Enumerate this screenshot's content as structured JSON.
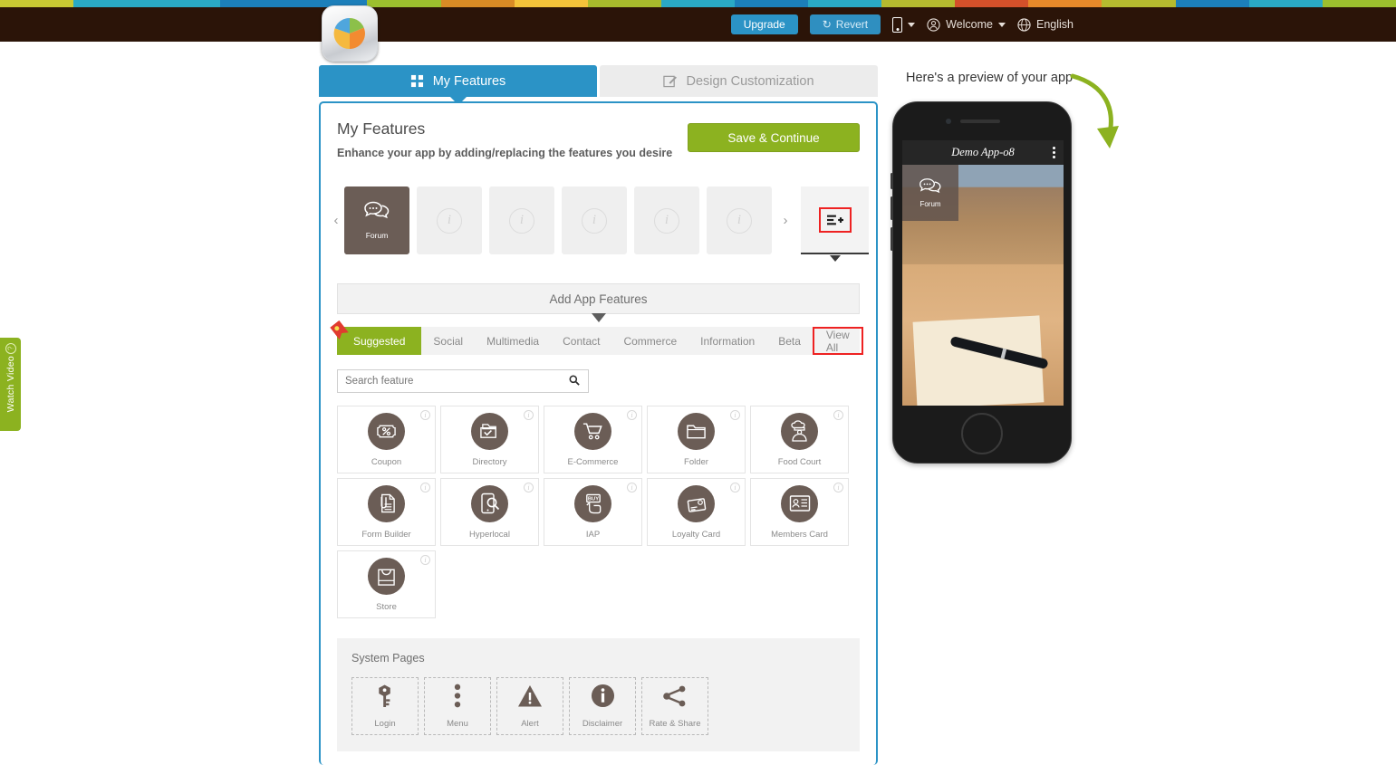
{
  "topbar": {
    "stripe_colors": [
      "#c9c933",
      "#2aa9c4",
      "#2aa9c4",
      "#1c7fba",
      "#1c7fba",
      "#9cbf2e",
      "#d98b25",
      "#f4c33a",
      "#a8bb2c",
      "#2aa9c4",
      "#1c7fba",
      "#2aa9c4",
      "#b5bb2f",
      "#d4502a",
      "#e7892a",
      "#b5bb2f",
      "#1c7fba",
      "#2aa9c4",
      "#9cbf2e"
    ],
    "background": "#2b1408",
    "upgrade_label": "Upgrade",
    "revert_label": "Revert",
    "revert_icon": "undo-icon",
    "device_icon": "mobile-device-icon",
    "welcome_label": "Welcome",
    "welcome_icon": "user-avatar-icon",
    "language_label": "English",
    "language_icon": "globe-icon",
    "logo_icon": "pie-chart-app-logo"
  },
  "tabs": [
    {
      "label": "My Features",
      "icon": "grid-squares-icon",
      "active": true
    },
    {
      "label": "Design Customization",
      "icon": "pencil-square-icon",
      "active": false
    }
  ],
  "panel": {
    "title": "My Features",
    "subtitle": "Enhance your app by adding/replacing the features you desire",
    "save_label": "Save & Continue",
    "accent_color": "#2b93c6",
    "save_color": "#8cb220"
  },
  "carousel": {
    "prev_icon": "chevron-left-icon",
    "next_icon": "chevron-right-icon",
    "tiles": [
      {
        "label": "Forum",
        "icon": "chat-bubbles-icon",
        "filled": true
      },
      {
        "label": "",
        "icon": "info-circle-icon",
        "filled": false
      },
      {
        "label": "",
        "icon": "info-circle-icon",
        "filled": false
      },
      {
        "label": "",
        "icon": "info-circle-icon",
        "filled": false
      },
      {
        "label": "",
        "icon": "info-circle-icon",
        "filled": false
      },
      {
        "label": "",
        "icon": "info-circle-icon",
        "filled": false
      }
    ],
    "add_button_icon": "list-plus-icon",
    "add_button_highlight": "#ee2222"
  },
  "add_features": {
    "label": "Add App Features"
  },
  "categories": {
    "items": [
      {
        "label": "Suggested",
        "selected": true,
        "outlined": false
      },
      {
        "label": "Social",
        "selected": false,
        "outlined": false
      },
      {
        "label": "Multimedia",
        "selected": false,
        "outlined": false
      },
      {
        "label": "Contact",
        "selected": false,
        "outlined": false
      },
      {
        "label": "Commerce",
        "selected": false,
        "outlined": false
      },
      {
        "label": "Information",
        "selected": false,
        "outlined": false
      },
      {
        "label": "Beta",
        "selected": false,
        "outlined": false
      },
      {
        "label": "View All",
        "selected": false,
        "outlined": true
      }
    ]
  },
  "search": {
    "placeholder": "Search feature",
    "value": "",
    "icon": "search-icon"
  },
  "features": [
    {
      "label": "Coupon",
      "icon": "coupon-percent-icon"
    },
    {
      "label": "Directory",
      "icon": "folder-check-icon"
    },
    {
      "label": "E-Commerce",
      "icon": "shopping-cart-icon"
    },
    {
      "label": "Folder",
      "icon": "folder-icon"
    },
    {
      "label": "Food Court",
      "icon": "chef-icon"
    },
    {
      "label": "Form Builder",
      "icon": "document-clip-icon"
    },
    {
      "label": "Hyperlocal",
      "icon": "phone-magnifier-icon"
    },
    {
      "label": "IAP",
      "icon": "buy-hand-icon"
    },
    {
      "label": "Loyalty Card",
      "icon": "loyalty-card-icon"
    },
    {
      "label": "Members Card",
      "icon": "members-card-icon"
    },
    {
      "label": "Store",
      "icon": "shopping-bag-icon"
    }
  ],
  "system_pages": {
    "title": "System Pages",
    "items": [
      {
        "label": "Login",
        "icon": "key-icon"
      },
      {
        "label": "Menu",
        "icon": "kebab-menu-icon"
      },
      {
        "label": "Alert",
        "icon": "warning-triangle-icon"
      },
      {
        "label": "Disclaimer",
        "icon": "info-circle-filled-icon"
      },
      {
        "label": "Rate & Share",
        "icon": "share-nodes-icon"
      }
    ]
  },
  "preview": {
    "heading": "Here's a preview of your app",
    "arrow_color": "#8cb220",
    "app_name": "Demo App-o8",
    "menu_icon": "kebab-menu-icon",
    "tile_label": "Forum",
    "tile_icon": "chat-bubbles-icon"
  },
  "watch_video": {
    "label": "Watch Video",
    "icon": "question-circle-icon",
    "color": "#8cb220"
  }
}
